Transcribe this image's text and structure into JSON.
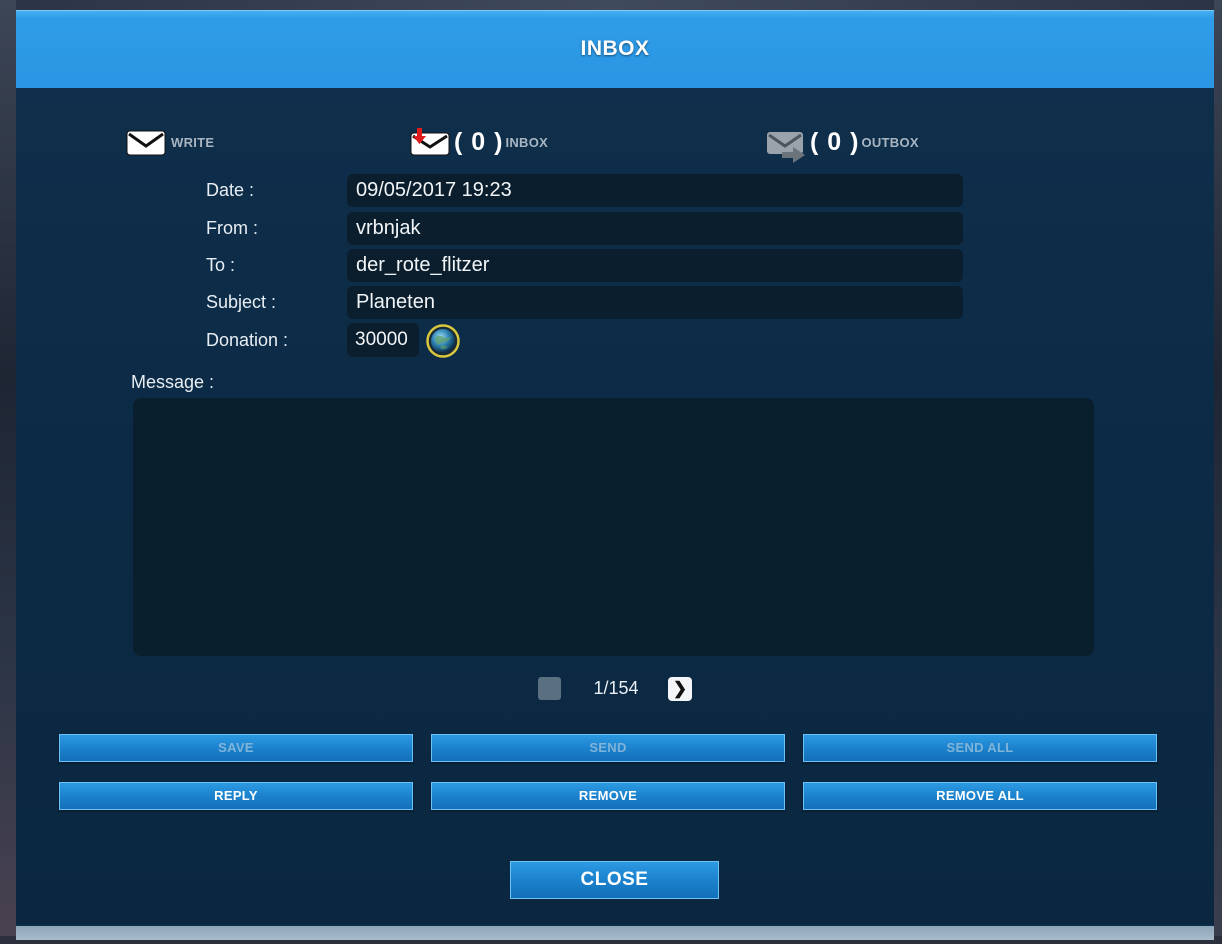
{
  "window": {
    "title": "INBOX"
  },
  "tabs": {
    "write": {
      "label": "WRITE"
    },
    "inbox": {
      "label": "INBOX",
      "count": "( 0 )"
    },
    "outbox": {
      "label": "OUTBOX",
      "count": "( 0 )"
    }
  },
  "message": {
    "date_label": "Date :",
    "date_value": "09/05/2017 19:23",
    "from_label": "From :",
    "from_value": "vrbnjak",
    "to_label": "To :",
    "to_value": "der_rote_flitzer",
    "subject_label": "Subject :",
    "subject_value": "Planeten",
    "donation_label": "Donation :",
    "donation_value": "30000",
    "message_label": "Message :",
    "body": ""
  },
  "pagination": {
    "text": "1/154",
    "next_glyph": "❯"
  },
  "buttons": {
    "save": "SAVE",
    "send": "SEND",
    "send_all": "SEND ALL",
    "reply": "REPLY",
    "remove": "REMOVE",
    "remove_all": "REMOVE ALL",
    "close": "CLOSE"
  },
  "colors": {
    "titlebar": "#2a96e3",
    "panel": "#0c2a45",
    "field_bg": "#0b1e2d",
    "button": "#1c82cd",
    "disabled_text": "#7fb3d8"
  },
  "icons": {
    "write": "envelope-icon",
    "inbox": "envelope-incoming-icon",
    "outbox": "envelope-outgoing-icon",
    "donation": "planet-coin-icon"
  }
}
